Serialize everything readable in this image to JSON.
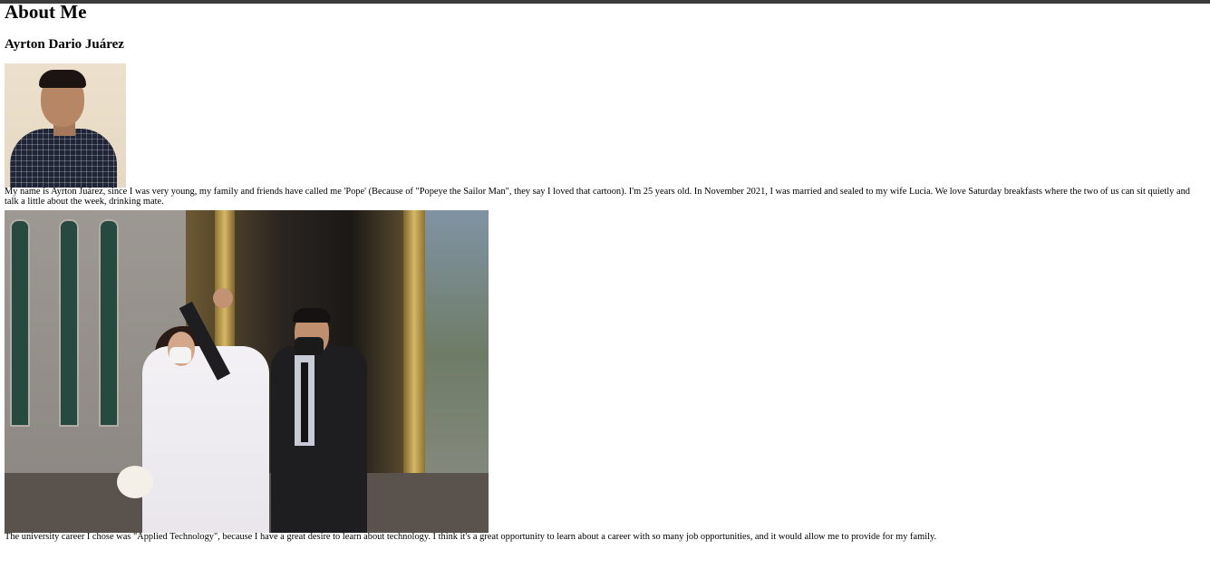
{
  "page": {
    "title": "About Me",
    "name": "Ayrton Dario Juárez",
    "paragraphs": {
      "intro": "My name is Ayrton Juárez, since I was very young, my family and friends have called me 'Pope' (Because of \"Popeye the Sailor Man\", they say I loved that cartoon). I'm 25 years old. In November 2021, I was married and sealed to my wife Lucia. We love Saturday breakfasts where the two of us can sit quietly and talk a little about the week, drinking mate.",
      "career": "The university career I chose was \"Applied Technology\", because I have a great desire to learn about technology. I think it's a great opportunity to learn about a career with so many job opportunities, and it would allow me to provide for my family."
    }
  },
  "colors": {
    "top_bar": "#3b3b3b",
    "text": "#000000",
    "background": "#ffffff"
  }
}
